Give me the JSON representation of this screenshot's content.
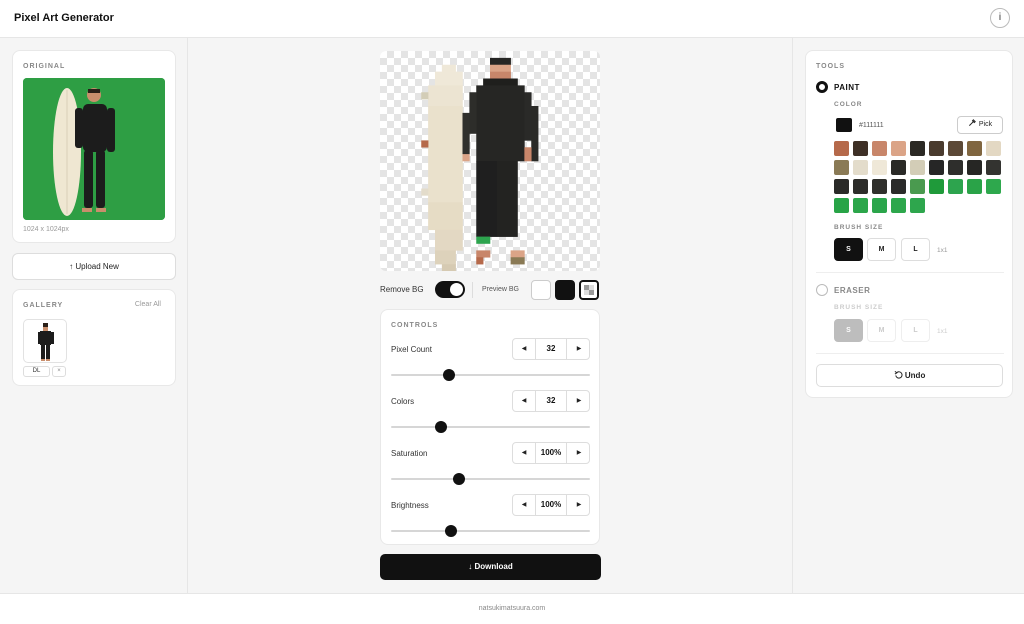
{
  "header": {
    "title": "Pixel Art Generator",
    "info_label": "i"
  },
  "left": {
    "original_label": "ORIGINAL",
    "original_dims": "1024 x 1024px",
    "upload_label": "↑ Upload New",
    "gallery_label": "GALLERY",
    "clear_all_label": "Clear All",
    "gallery_items": [
      {
        "dl_label": "DL",
        "remove_label": "×"
      }
    ]
  },
  "center": {
    "remove_bg_label": "Remove BG",
    "remove_bg_on": true,
    "preview_bg_label": "Preview BG",
    "preview_bg_options": [
      "white",
      "black",
      "transparent"
    ],
    "preview_bg_selected": "transparent",
    "controls_label": "CONTROLS",
    "controls": [
      {
        "label": "Pixel Count",
        "value": "32",
        "fraction": 0.29
      },
      {
        "label": "Colors",
        "value": "32",
        "fraction": 0.25
      },
      {
        "label": "Saturation",
        "value": "100%",
        "fraction": 0.34
      },
      {
        "label": "Brightness",
        "value": "100%",
        "fraction": 0.3
      }
    ],
    "download_label": "↓ Download"
  },
  "right": {
    "tools_label": "TOOLS",
    "paint_label": "PAINT",
    "color_label": "COLOR",
    "current_color": "#111111",
    "pick_label": "Pick",
    "palette": [
      "#b5694a",
      "#3e3026",
      "#c8866a",
      "#dba487",
      "#2b2924",
      "#4a3b2e",
      "#5c4937",
      "#806640",
      "#e3d8c3",
      "#8a7a55",
      "#e3dccb",
      "#efe8d8",
      "#2a2a27",
      "#d3cdb7",
      "#262626",
      "#2e2e2c",
      "#262624",
      "#333330",
      "#2a2a28",
      "#2d2d2a",
      "#30302c",
      "#2b2b29",
      "#4a9a4f",
      "#1f9a3a",
      "#2da44e",
      "#2aa348",
      "#2ea84d",
      "#28a447",
      "#2ca64a",
      "#2ba54b",
      "#2da74c",
      "#2ea64d"
    ],
    "brush_size_label": "BRUSH SIZE",
    "sizes": [
      "S",
      "M",
      "L"
    ],
    "paint_size_note": "1x1",
    "eraser_label": "ERASER",
    "eraser_size_note": "1x1",
    "undo_label": "Undo"
  },
  "footer": {
    "text": "natsukimatsuura.com"
  }
}
